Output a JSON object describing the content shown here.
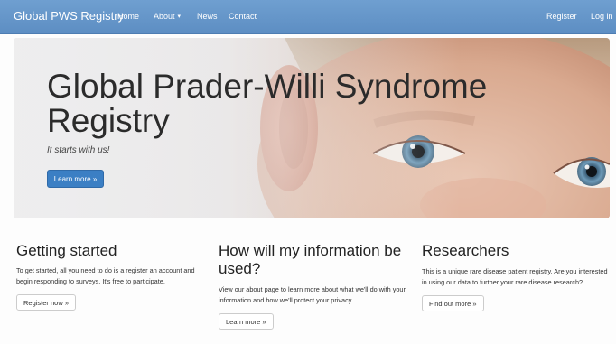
{
  "navbar": {
    "brand": "Global PWS Registry",
    "links": {
      "home": "Home",
      "about": "About",
      "news": "News",
      "contact": "Contact"
    },
    "about_caret_icon": "caret-down-icon",
    "right_links": {
      "register": "Register",
      "login": "Log in"
    },
    "background_color": "#6496c8"
  },
  "hero": {
    "title": "Global Prader-Willi Syndrome Registry",
    "tagline": "It starts with us!",
    "button_label": "Learn more »",
    "button_color": "#3b7fc4"
  },
  "columns": [
    {
      "heading": "Getting started",
      "text": "To get started, all you need to do is a register an account and begin responding to surveys. It's free to participate.",
      "button_label": "Register now »"
    },
    {
      "heading": "How will my information be used?",
      "text": "View our about page to learn more about what we'll do with your information and how we'll protect your privacy.",
      "button_label": "Learn more »"
    },
    {
      "heading": "Researchers",
      "text": "This is a unique rare disease patient registry. Are you interested in using our data to further your rare disease research?",
      "button_label": "Find out more »"
    }
  ]
}
